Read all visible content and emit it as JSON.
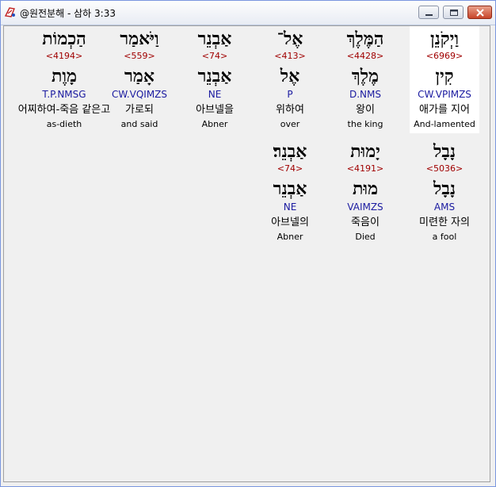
{
  "window": {
    "title": "@원전분해 - 삼하 3:33",
    "icon": "app-icon"
  },
  "words": [
    {
      "hebrew": "וַיְקֹנֵן",
      "strong": "<6969>",
      "lexeme": "קִין",
      "morph": "CW.VPIMZS",
      "korean": "애가를 지어",
      "english": "And-lamented",
      "selected": true
    },
    {
      "hebrew": "הַמֶּלֶךְ",
      "strong": "<4428>",
      "lexeme": "מֶלֶךְ",
      "morph": "D.NMS",
      "korean": "왕이",
      "english": "the king",
      "selected": false
    },
    {
      "hebrew": "אֶל־",
      "strong": "<413>",
      "lexeme": "אֶל",
      "morph": "P",
      "korean": "위하여",
      "english": "over",
      "selected": false
    },
    {
      "hebrew": "אַבְנֵר",
      "strong": "<74>",
      "lexeme": "אַבְנֵר",
      "morph": "NE",
      "korean": "아브넬을",
      "english": "Abner",
      "selected": false
    },
    {
      "hebrew": "וַיֹּאמַר",
      "strong": "<559>",
      "lexeme": "אָמַר",
      "morph": "CW.VQIMZS",
      "korean": "가로되",
      "english": "and said",
      "selected": false
    },
    {
      "hebrew": "הַכְמוֹת",
      "strong": "<4194>",
      "lexeme": "מָוֶת",
      "morph": "T.P.NMSG",
      "korean": "어찌하여-죽음 같은고",
      "english": "as-dieth",
      "selected": false
    },
    {
      "hebrew": "נָבָל",
      "strong": "<5036>",
      "lexeme": "נָבָל",
      "morph": "AMS",
      "korean": "미련한 자의",
      "english": "a fool",
      "selected": false
    },
    {
      "hebrew": "יָמוּת",
      "strong": "<4191>",
      "lexeme": "מוּת",
      "morph": "VAIMZS",
      "korean": "죽음이",
      "english": "Died",
      "selected": false
    },
    {
      "hebrew": "אַבְנֵר׃",
      "strong": "<74>",
      "lexeme": "אַבְנֵר",
      "morph": "NE",
      "korean": "아브넬의",
      "english": "Abner",
      "selected": false
    }
  ],
  "colors": {
    "strong": "#a00000",
    "morph": "#1a1aa0",
    "selected_bg": "#ffffff",
    "window_bg": "#f0f0f0"
  }
}
